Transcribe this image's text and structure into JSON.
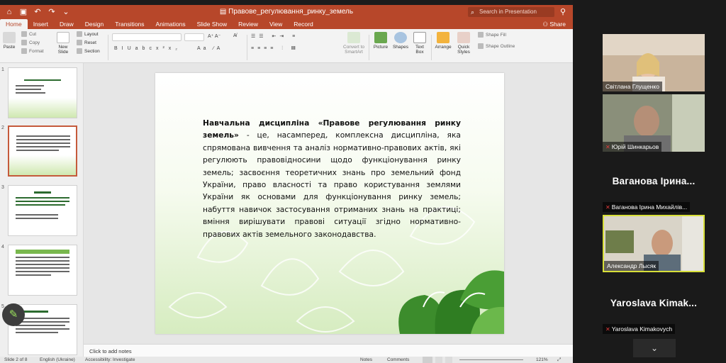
{
  "window": {
    "title": "Правове_регулювання_ринку_земель",
    "search_placeholder": "Search in Presentation",
    "share_label": "Share"
  },
  "tabs": [
    "Home",
    "Insert",
    "Draw",
    "Design",
    "Transitions",
    "Animations",
    "Slide Show",
    "Review",
    "View",
    "Record"
  ],
  "ribbon": {
    "paste": "Paste",
    "cut": "Cut",
    "copy": "Copy",
    "format": "Format",
    "new_slide": "New Slide",
    "layout": "Layout",
    "reset": "Reset",
    "section": "Section",
    "convert": "Convert to SmartArt",
    "picture": "Picture",
    "shapes": "Shapes",
    "text_box": "Text Box",
    "arrange": "Arrange",
    "quick_styles": "Quick Styles",
    "shape_fill": "Shape Fill",
    "shape_outline": "Shape Outline"
  },
  "thumbnails": [
    {
      "num": "1"
    },
    {
      "num": "2"
    },
    {
      "num": "3"
    },
    {
      "num": "4"
    },
    {
      "num": "5"
    }
  ],
  "slide": {
    "lead": "Навчальна дисципліна «Правове регулювання ринку земель»",
    "body": " - це, насамперед, комплексна дисципліна, яка спрямована вивчення та аналіз нормативно-правових актів, які регулюють правовідносини щодо функціонування ринку земель; засвоєння теоретичних знань про земельний фонд України, право власності та право користування землями України як основами для функціонування ринку земель; набуття навичок застосування отриманих знань на практиці; вміння вирішувати правові ситуації згідно нормативно-правових актів земельного законодавства."
  },
  "notes_placeholder": "Click to add notes",
  "status": {
    "slide_of": "Slide 2 of 8",
    "language": "English (Ukraine)",
    "accessibility": "Accessibility: Investigate",
    "notes": "Notes",
    "comments": "Comments",
    "zoom": "121%"
  },
  "participants": [
    {
      "name": "Світлана Глущенко",
      "muted": false
    },
    {
      "name": "Юрій Шинкарьов",
      "muted": true
    },
    {
      "name": "Ваганова Ірина Михайлів...",
      "display": "Ваганова Ірина...",
      "muted": true
    },
    {
      "name": "Александр Лысяк",
      "muted": false
    },
    {
      "name": "Yaroslava Kimakovych",
      "display": "Yaroslava Kimak...",
      "muted": true
    }
  ],
  "colors": {
    "ppt_accent": "#b7472a",
    "active_speaker": "#d7df39",
    "slide_green": "#3c8c2c"
  }
}
